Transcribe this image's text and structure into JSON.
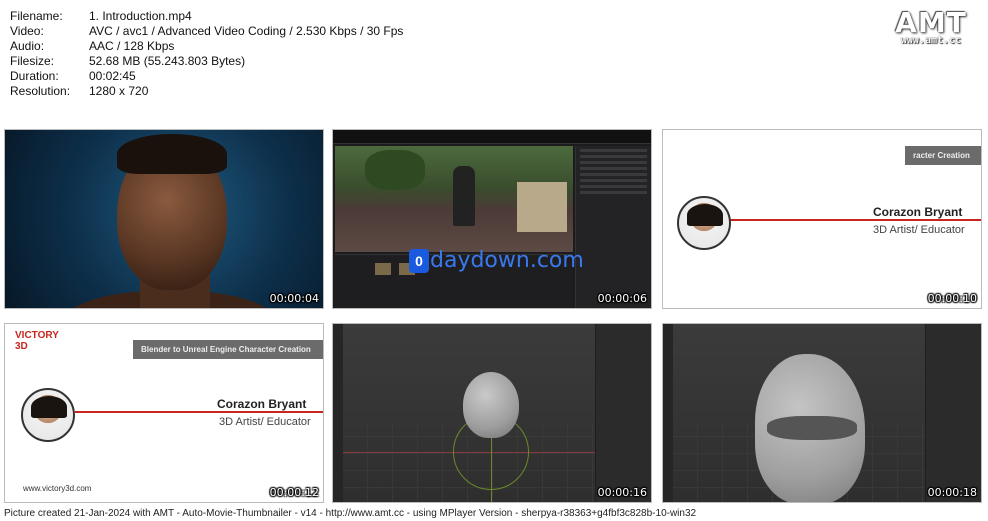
{
  "meta": [
    {
      "key": "Filename:",
      "value": "1. Introduction.mp4"
    },
    {
      "key": "Video:",
      "value": "AVC / avc1 / Advanced Video Coding / 2.530 Kbps / 30 Fps"
    },
    {
      "key": "Audio:",
      "value": "AAC / 128 Kbps"
    },
    {
      "key": "Filesize:",
      "value": "52.68 MB (55.243.803 Bytes)"
    },
    {
      "key": "Duration:",
      "value": "00:02:45"
    },
    {
      "key": "Resolution:",
      "value": "1280 x 720"
    }
  ],
  "logo": {
    "big": "AMT",
    "small": "www.amt.cc"
  },
  "thumbs": [
    {
      "timestamp": "00:00:04"
    },
    {
      "timestamp": "00:00:06",
      "watermark": "daydown.com",
      "watermark_badge": "0"
    },
    {
      "timestamp": "00:00:10",
      "course": "racter Creation",
      "name": "Corazon Bryant",
      "role": "3D Artist/ Educator"
    },
    {
      "timestamp": "00:00:12",
      "brand_main": "VICTORY",
      "brand_sub": "3D",
      "course": "Blender to Unreal Engine Character Creation",
      "name": "Corazon Bryant",
      "role": "3D Artist/ Educator",
      "site": "www.victory3d.com"
    },
    {
      "timestamp": "00:00:16"
    },
    {
      "timestamp": "00:00:18"
    }
  ],
  "footer": "Picture created 21-Jan-2024 with AMT - Auto-Movie-Thumbnailer - v14 - http://www.amt.cc - using MPlayer Version - sherpya-r38363+g4fbf3c828b-10-win32"
}
